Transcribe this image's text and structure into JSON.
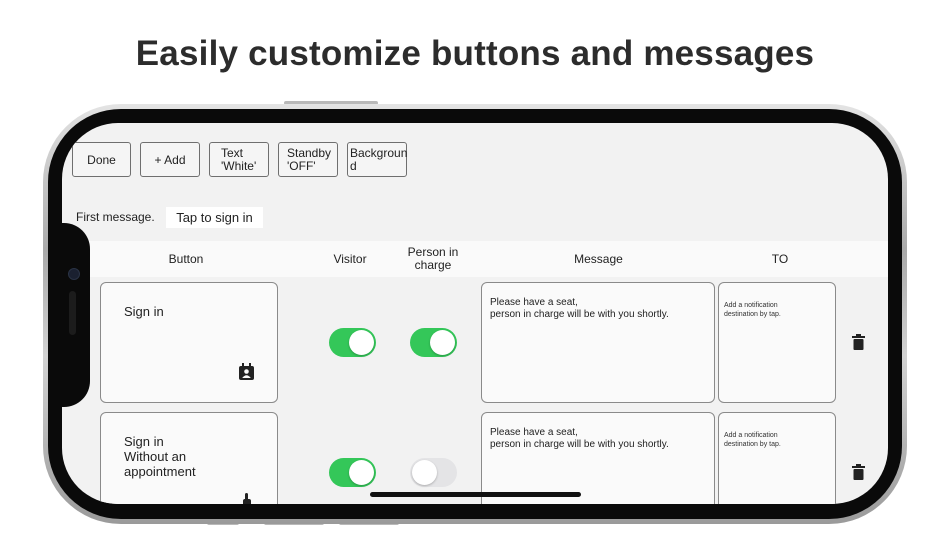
{
  "headline": "Easily customize buttons and messages",
  "toolbar": {
    "done": "Done",
    "add": "+ Add",
    "text_color": "Text\n'White'",
    "standby": "Standby\n'OFF'",
    "background": "Backgroun\nd"
  },
  "first_message": {
    "label": "First message.",
    "value": "Tap to sign in"
  },
  "table": {
    "headers": {
      "button": "Button",
      "visitor": "Visitor",
      "person_in_charge": "Person in\ncharge",
      "message": "Message",
      "to": "TO"
    },
    "rows": [
      {
        "button_label": "Sign in",
        "visitor_on": true,
        "person_in_charge_on": true,
        "message": "Please have a seat,\nperson in charge will be with you shortly.",
        "to": "Add a notification\ndestination by tap.",
        "button_icon": "contact-calendar-icon"
      },
      {
        "button_label": "Sign in\nWithout an\nappointment",
        "visitor_on": true,
        "person_in_charge_on": false,
        "message": "Please have a seat,\nperson in charge will be with you shortly.",
        "to": "Add a notification\ndestination by tap.",
        "button_icon": "tap-hand-icon"
      }
    ]
  },
  "colors": {
    "toggle_on": "#34c759",
    "toggle_off": "#e4e4e6",
    "screen_bg": "#f2f2f2"
  }
}
